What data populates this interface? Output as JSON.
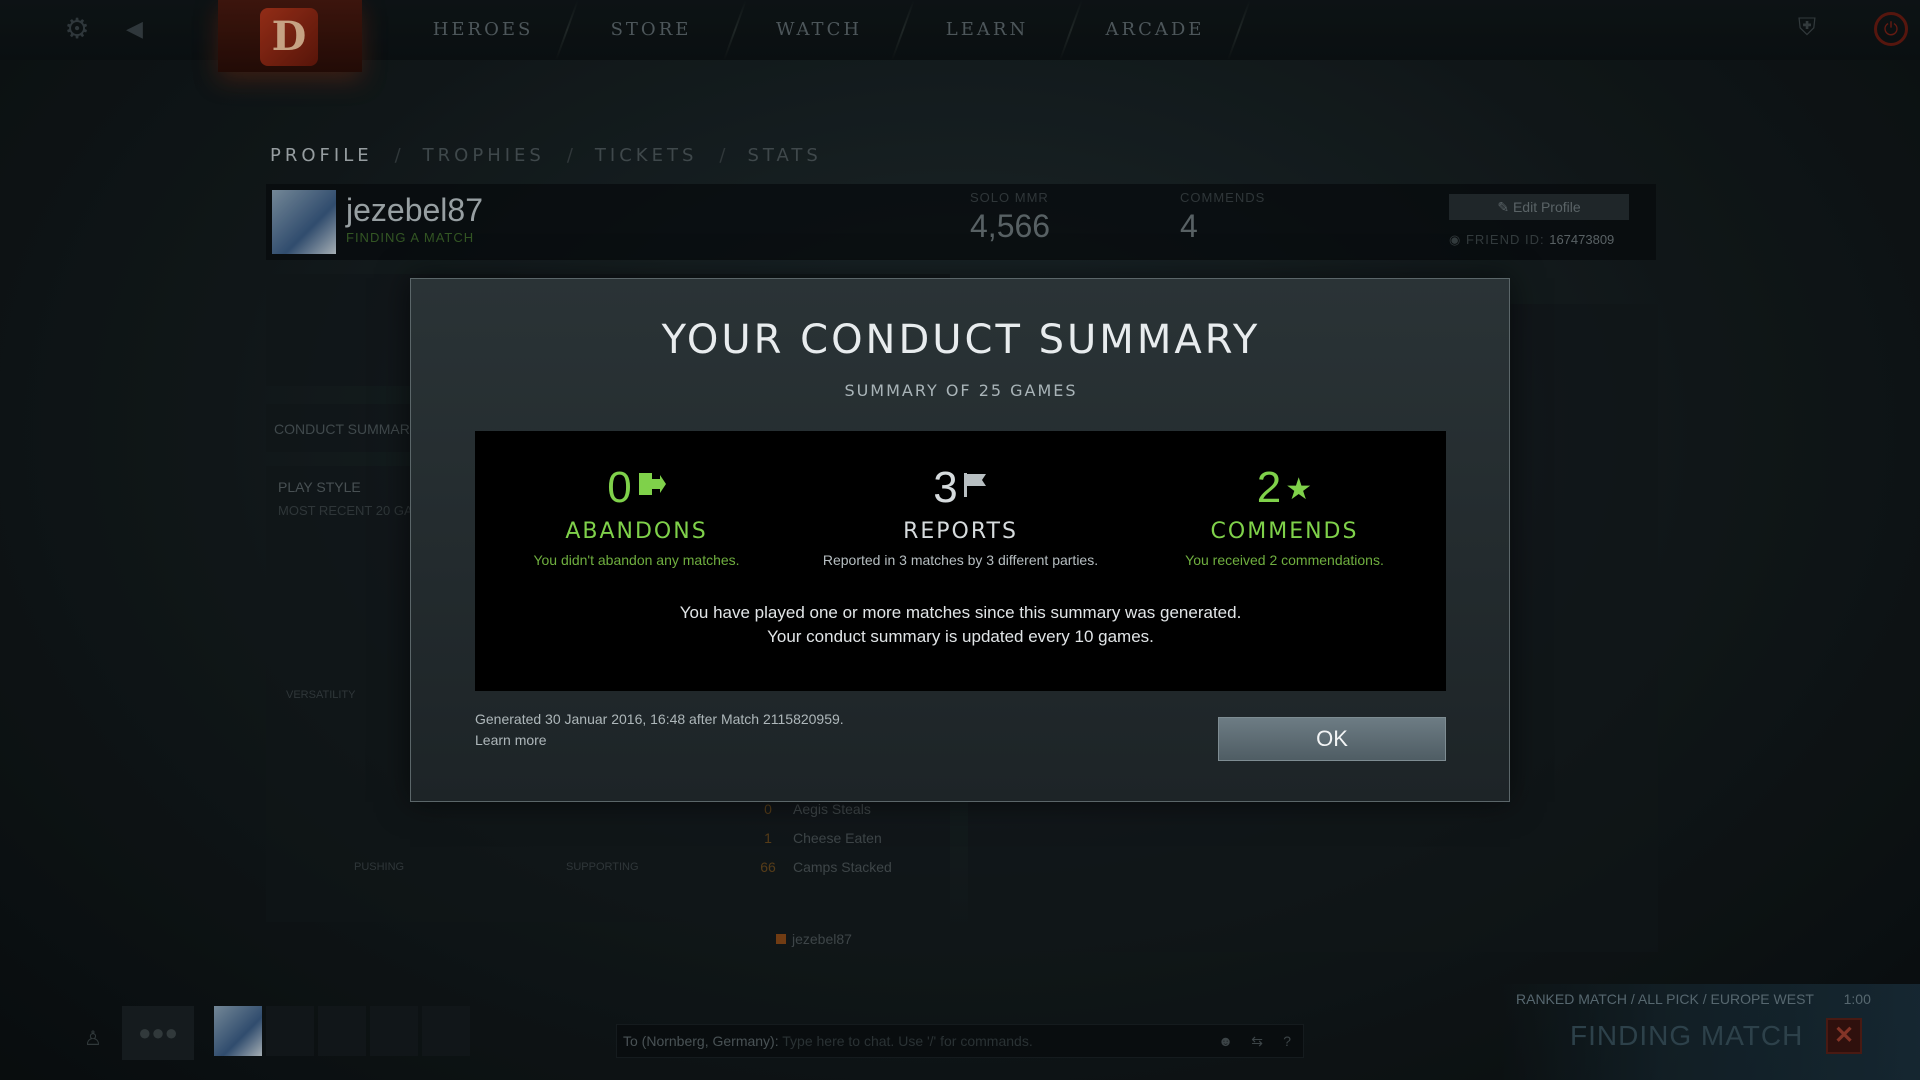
{
  "nav": {
    "items": [
      {
        "label": "HEROES"
      },
      {
        "label": "STORE"
      },
      {
        "label": "WATCH"
      },
      {
        "label": "LEARN"
      },
      {
        "label": "ARCADE"
      }
    ]
  },
  "profile_tabs": {
    "items": [
      {
        "label": "PROFILE"
      },
      {
        "label": "TROPHIES"
      },
      {
        "label": "TICKETS"
      },
      {
        "label": "STATS"
      }
    ],
    "separator": "/"
  },
  "profile": {
    "name": "jezebel87",
    "status": "FINDING A MATCH",
    "solo_mmr_label": "SOLO MMR",
    "solo_mmr": "4,566",
    "commends_label": "COMMENDS",
    "commends": "4",
    "edit_label": "Edit Profile",
    "friend_id_label": "FRIEND ID:",
    "friend_id": "167473809"
  },
  "background": {
    "conduct_label": "CONDUCT SUMMARY",
    "play_style_label": "PLAY STYLE",
    "recent_label": "MOST RECENT 20 GA",
    "versatility_label": "VERSATILITY",
    "pushing_label": "PUSHING",
    "supporting_label": "SUPPORTING",
    "stats": [
      {
        "value": "0",
        "label": "Aegis Steals"
      },
      {
        "value": "1",
        "label": "Cheese Eaten"
      },
      {
        "value": "66",
        "label": "Camps Stacked"
      }
    ],
    "legend_name": "jezebel87"
  },
  "modal": {
    "title": "YOUR CONDUCT SUMMARY",
    "subtitle": "SUMMARY OF 25 GAMES",
    "abandons": {
      "value": "0",
      "label": "ABANDONS",
      "desc": "You didn't abandon any matches."
    },
    "reports": {
      "value": "3",
      "label": "REPORTS",
      "desc": "Reported in 3 matches by 3 different parties."
    },
    "commends": {
      "value": "2",
      "label": "COMMENDS",
      "desc": "You received 2 commendations."
    },
    "notice_line1": "You have played one or more matches since this summary was generated.",
    "notice_line2": "Your conduct summary is updated every 10 games.",
    "generated": "Generated 30 Januar 2016, 16:48 after Match 2115820959.",
    "learn_more": "Learn more",
    "ok_label": "OK",
    "colors": {
      "accent_green": "#7fd14a",
      "button": "#5e6c73"
    }
  },
  "chat": {
    "prefix": "To (Nornberg, Germany):",
    "placeholder": "Type here to chat. Use '/' for commands."
  },
  "matchmaking": {
    "mode": "RANKED MATCH",
    "pick": "ALL PICK",
    "region": "EUROPE WEST",
    "timer": "1:00",
    "status": "FINDING MATCH"
  },
  "icons": {
    "abandon": "door-exit-icon",
    "report": "flag-icon",
    "commend": "star-icon"
  }
}
